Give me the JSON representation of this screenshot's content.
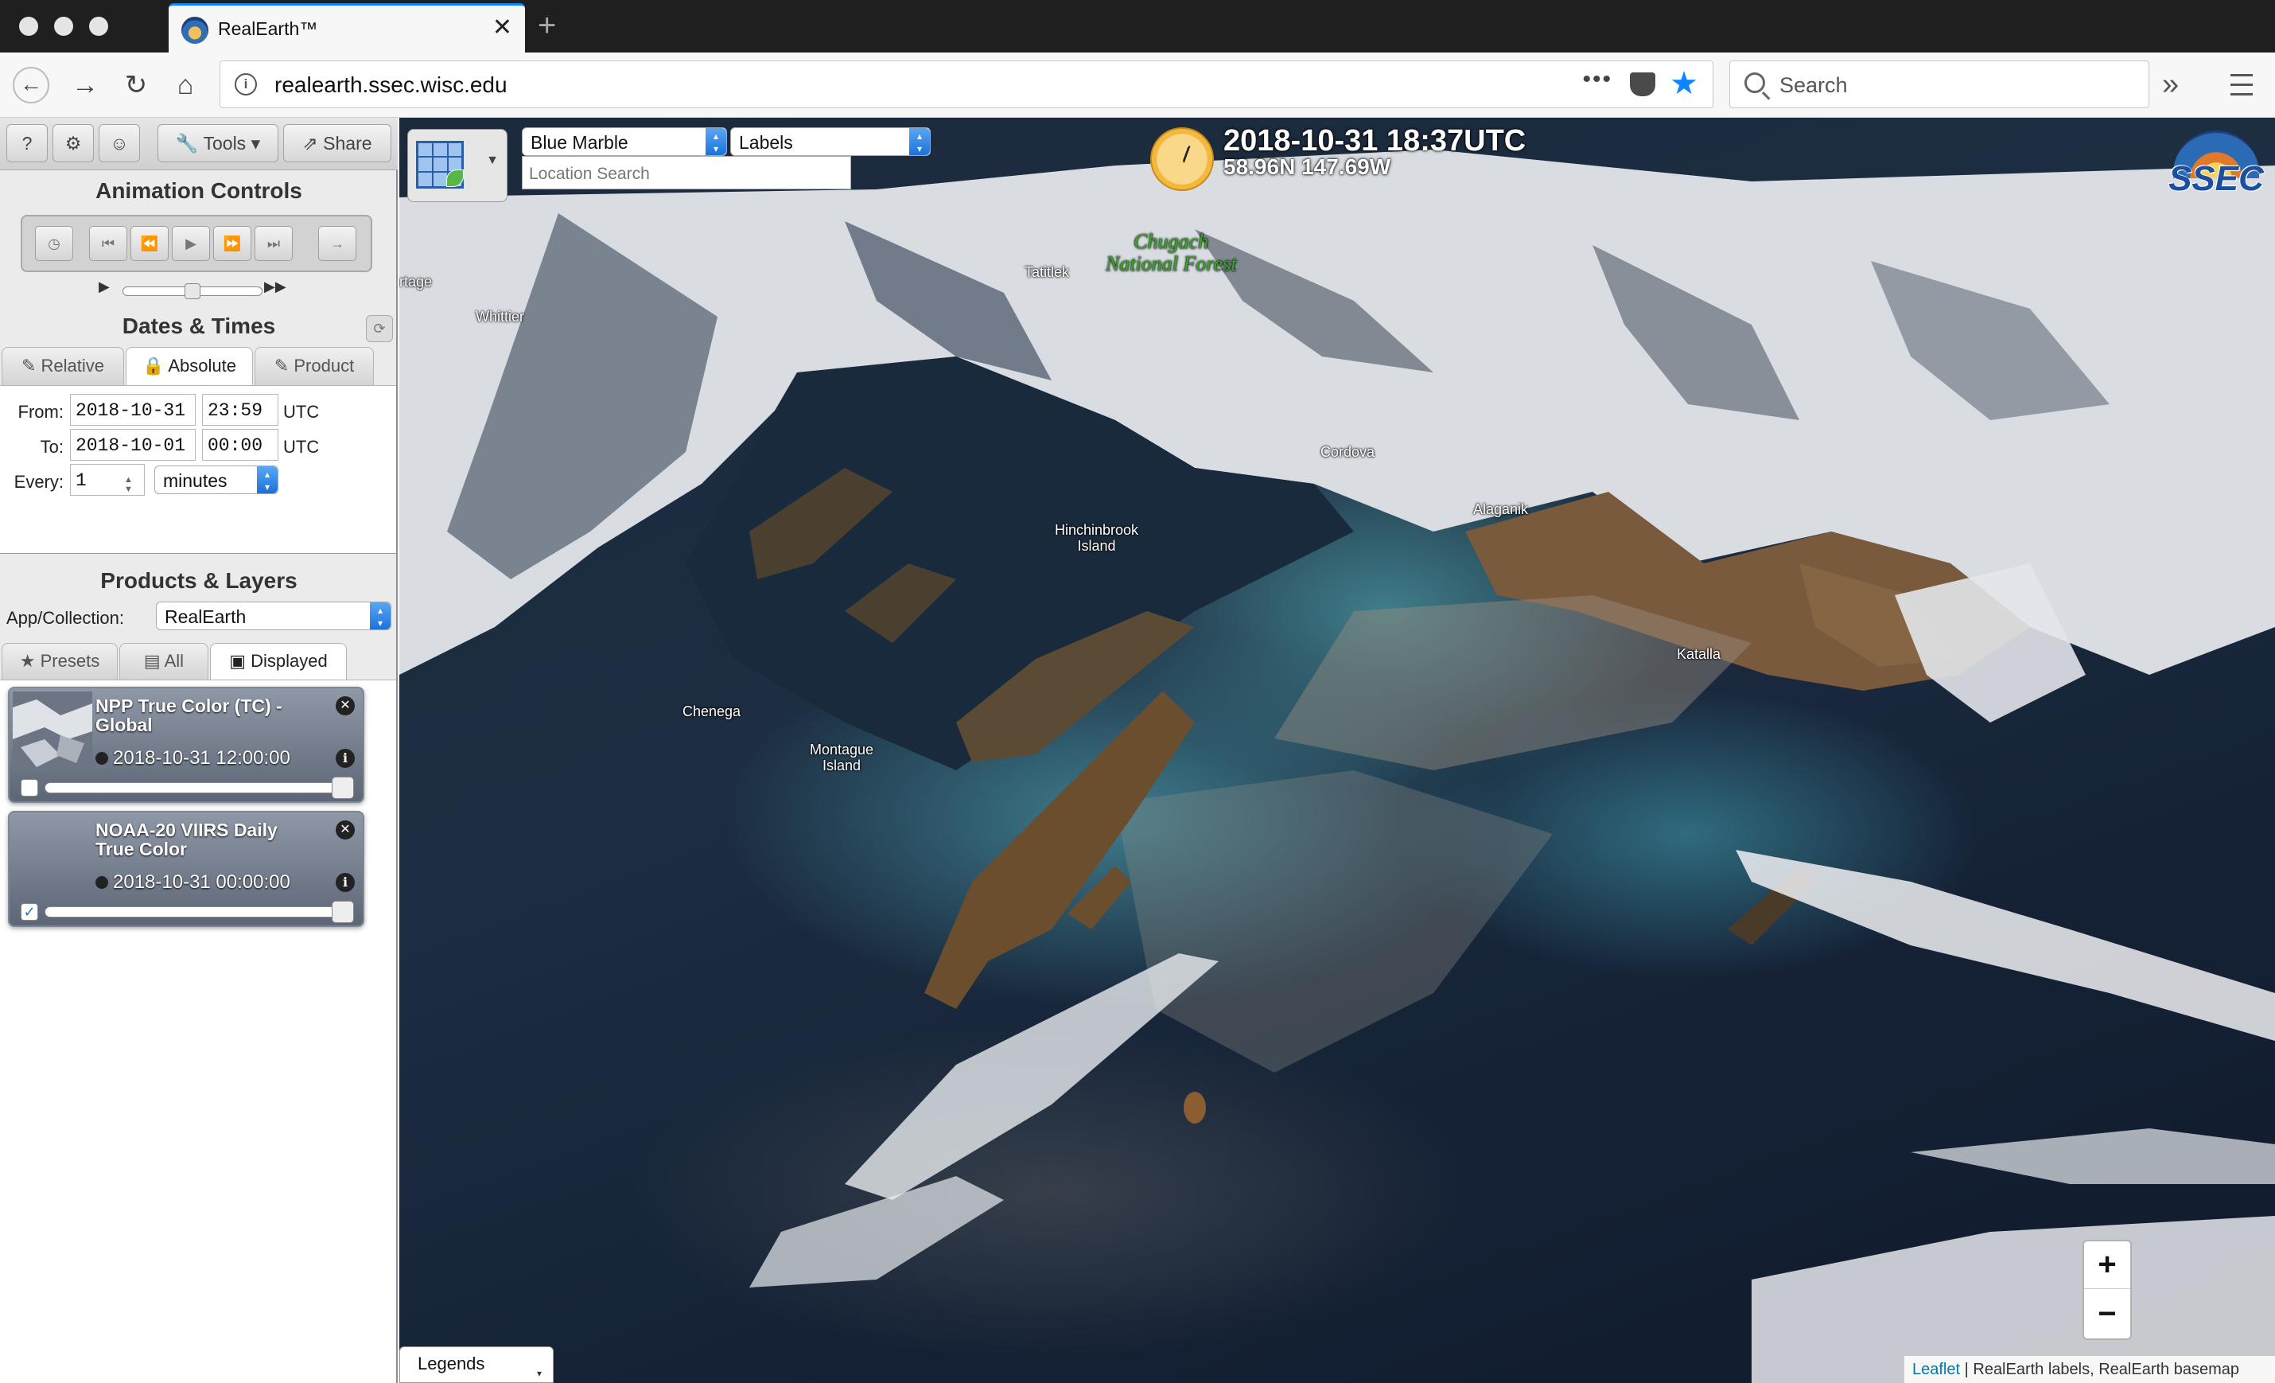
{
  "browser": {
    "tab_title": "RealEarth™",
    "tab_close": "✕",
    "new_tab": "+",
    "url": "realearth.ssec.wisc.edu",
    "url_more": "•••",
    "search_placeholder": "Search",
    "overflow": "»",
    "nav": {
      "back": "←",
      "forward": "→",
      "reload": "↻",
      "home": "⌂"
    }
  },
  "toolbar": {
    "help": "?",
    "settings": "⚙",
    "user": "☺",
    "tools_label": "Tools",
    "tools_caret": "▾",
    "share_label": "Share"
  },
  "animation": {
    "title": "Animation Controls",
    "buttons": {
      "clock": "◷",
      "first": "⏮",
      "rewind": "⏪",
      "play": "▶",
      "forward": "⏩",
      "last": "⏭",
      "loop": "→"
    },
    "speed_slow": "▶",
    "speed_fast": "▶▶",
    "speed_level": 0.5
  },
  "dates": {
    "title": "Dates & Times",
    "refresh": "⟳",
    "tabs": {
      "relative": "Relative",
      "absolute": "Absolute",
      "product": "Product"
    },
    "tab_icons": {
      "relative": "✎",
      "absolute": "🔒",
      "product": "✎"
    },
    "from_label": "From:",
    "from_date": "2018-10-31",
    "from_time": "23:59",
    "from_unit": "UTC",
    "to_label": "To:",
    "to_date": "2018-10-01",
    "to_time": "00:00",
    "to_unit": "UTC",
    "every_label": "Every:",
    "every_value": "1",
    "every_unit": "minutes"
  },
  "products": {
    "title": "Products & Layers",
    "app_label": "App/Collection:",
    "app_value": "RealEarth",
    "tabs": {
      "presets": "Presets",
      "all": "All",
      "displayed": "Displayed"
    },
    "tab_icons": {
      "presets": "★",
      "all": "▤",
      "displayed": "▣"
    },
    "layers": [
      {
        "title": "NPP True Color (TC) - Global",
        "time": "2018-10-31 12:00:00",
        "checked": false,
        "check_mark": "",
        "opacity": 1.0
      },
      {
        "title": "NOAA-20 VIIRS Daily True Color",
        "time": "2018-10-31 00:00:00",
        "checked": true,
        "check_mark": "✓",
        "opacity": 1.0
      }
    ],
    "layer_close": "✕",
    "layer_info": "i"
  },
  "map": {
    "basemap": "Blue Marble",
    "labels": "Labels",
    "location_placeholder": "Location Search",
    "time": "2018-10-31 18:37UTC",
    "coords": "58.96N 147.69W",
    "logo_text": "SSEC",
    "place_labels": {
      "whittier": "Whittier",
      "portage": "rtage",
      "tatitlek": "Tatitlek",
      "forest": "Chugach\nNational Forest",
      "cordova": "Cordova",
      "alaganik": "Alaganik",
      "hinchinbrook": "Hinchinbrook\nIsland",
      "katalla": "Katalla",
      "chenega": "Chenega",
      "montague": "Montague\nIsland"
    },
    "zoom_in": "+",
    "zoom_out": "−",
    "legends": "Legends",
    "legends_caret": "▾",
    "attribution_link": "Leaflet",
    "attribution_text": " | RealEarth labels, RealEarth basemap"
  }
}
